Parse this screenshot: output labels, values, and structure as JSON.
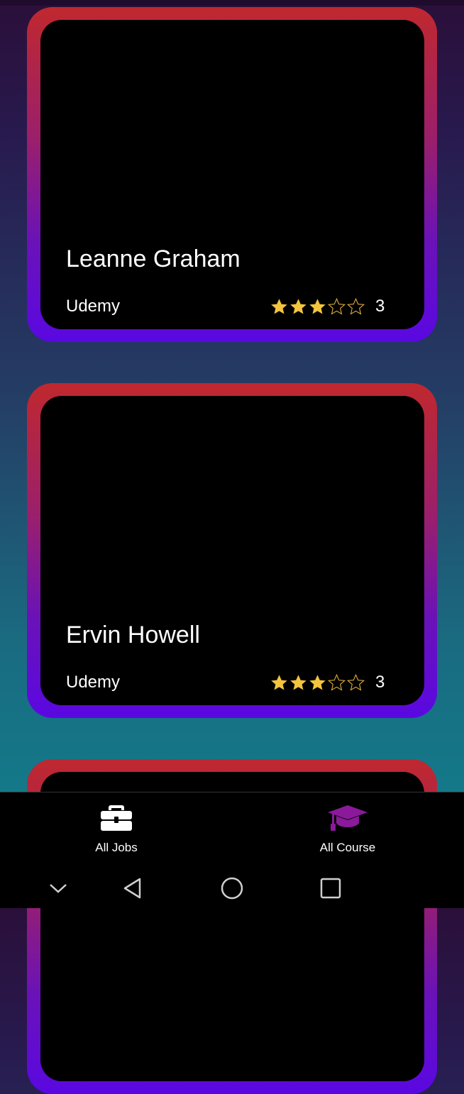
{
  "courses": [
    {
      "title": "Leanne Graham",
      "provider": "Udemy",
      "rating": 3,
      "rating_label": "3",
      "max_rating": 5
    },
    {
      "title": "Ervin Howell",
      "provider": "Udemy",
      "rating": 3,
      "rating_label": "3",
      "max_rating": 5
    }
  ],
  "bottom_nav": {
    "items": [
      {
        "label": "All Jobs",
        "icon": "briefcase-icon",
        "active": false,
        "color": "#ffffff"
      },
      {
        "label": "All Course",
        "icon": "graduation-cap-icon",
        "active": true,
        "color": "#8a1a9a"
      }
    ]
  },
  "system_nav": [
    "chevron-down-icon",
    "back-icon",
    "home-icon",
    "recents-icon"
  ],
  "colors": {
    "star_filled": "#f3c43e",
    "star_empty_outline": "#d9a93a",
    "card_border_top": "#c0282e",
    "card_border_bottom": "#5a08e2",
    "active_nav": "#8a1a9a"
  }
}
